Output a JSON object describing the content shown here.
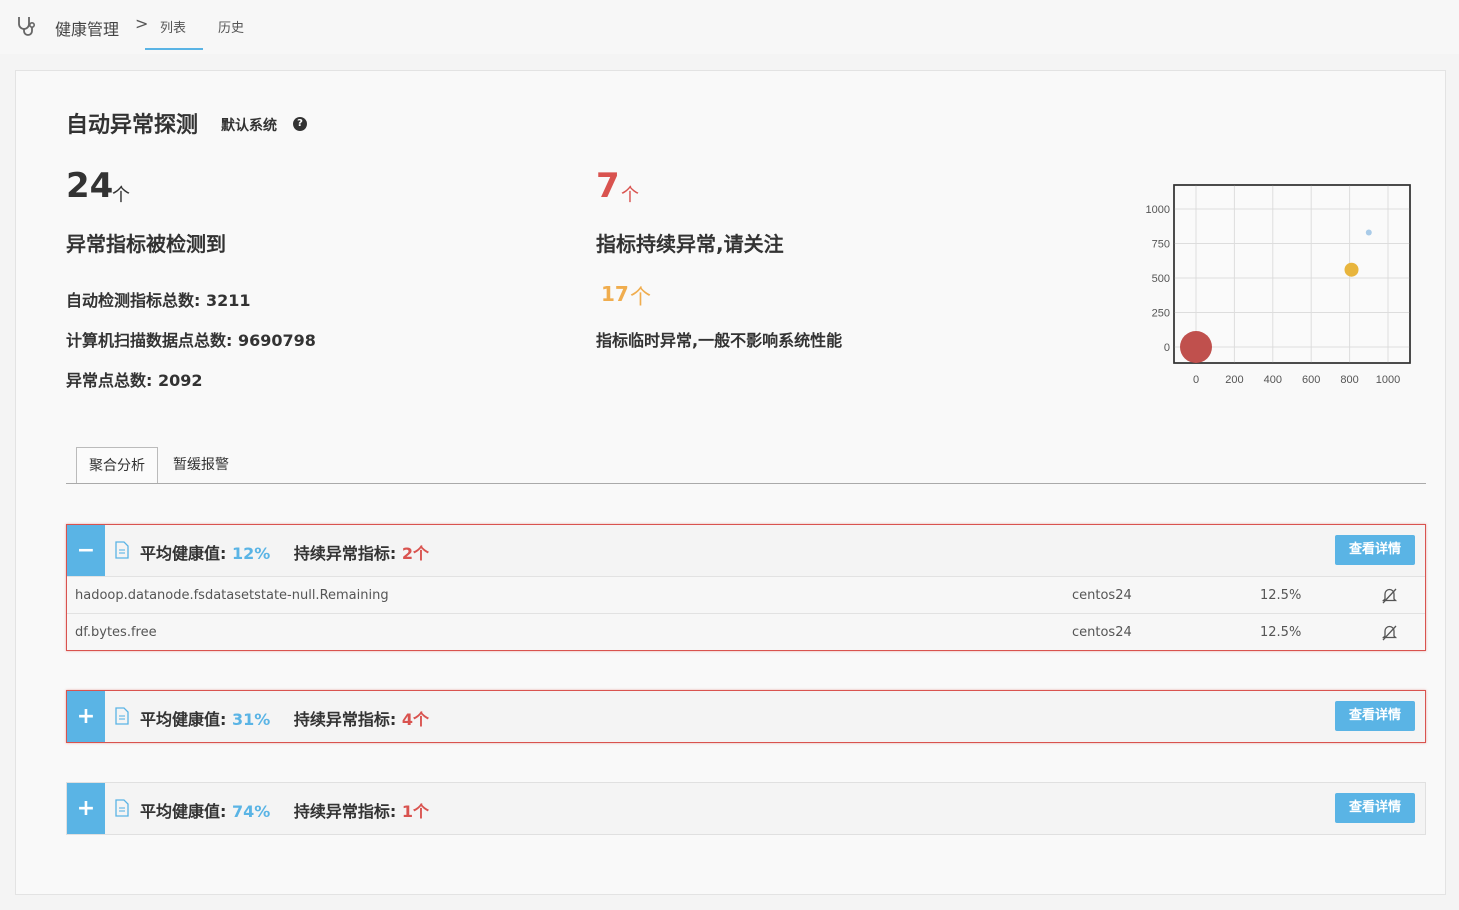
{
  "nav": {
    "title": "健康管理",
    "separator": ">",
    "tabs": [
      {
        "label": "列表",
        "active": true
      },
      {
        "label": "历史",
        "active": false
      }
    ]
  },
  "header": {
    "title": "自动异常探测",
    "subtitle": "默认系统",
    "help_glyph": "?"
  },
  "stats": {
    "detected": {
      "value": "24",
      "unit": "个",
      "label": "异常指标被检测到"
    },
    "persistent": {
      "value": "7",
      "unit": "个",
      "label": "指标持续异常,请关注"
    },
    "temporary": {
      "value": "17",
      "unit": "个",
      "label": "指标临时异常,一般不影响系统性能"
    },
    "totals": [
      "自动检测指标总数: 3211",
      "计算机扫描数据点总数: 9690798",
      "异常点总数: 2092"
    ]
  },
  "colors": {
    "accent": "#5ab4e5",
    "danger": "#d9534f",
    "warning": "#f0ad4e"
  },
  "chart_data": {
    "type": "scatter",
    "x_ticks": [
      "0",
      "200",
      "400",
      "600",
      "800",
      "1000"
    ],
    "y_ticks": [
      "1000",
      "750",
      "500",
      "250",
      "0"
    ],
    "xlim": [
      0,
      1000
    ],
    "ylim": [
      0,
      1000
    ],
    "grid": true,
    "points": [
      {
        "x": 0,
        "y": 0,
        "size": 16,
        "color": "#c0504d"
      },
      {
        "x": 810,
        "y": 560,
        "size": 7,
        "color": "#e8b53d"
      },
      {
        "x": 900,
        "y": 830,
        "size": 3,
        "color": "#a9cbe8"
      }
    ]
  },
  "tabs": [
    {
      "label": "聚合分析",
      "active": true
    },
    {
      "label": "暂缓报警",
      "active": false
    }
  ],
  "groups": [
    {
      "expanded": true,
      "alert": true,
      "toggle_glyph": "−",
      "health_label": "平均健康值:",
      "health_value": "12%",
      "anom_label": "持续异常指标:",
      "anom_value": "2个",
      "button_label": "查看详情",
      "rows": [
        {
          "metric": "hadoop.datanode.fsdatasetstate-null.Remaining",
          "host": "centos24",
          "percent": "12.5%"
        },
        {
          "metric": "df.bytes.free",
          "host": "centos24",
          "percent": "12.5%"
        }
      ]
    },
    {
      "expanded": false,
      "alert": true,
      "toggle_glyph": "+",
      "health_label": "平均健康值:",
      "health_value": "31%",
      "anom_label": "持续异常指标:",
      "anom_value": "4个",
      "button_label": "查看详情",
      "rows": []
    },
    {
      "expanded": false,
      "alert": false,
      "toggle_glyph": "+",
      "health_label": "平均健康值:",
      "health_value": "74%",
      "anom_label": "持续异常指标:",
      "anom_value": "1个",
      "button_label": "查看详情",
      "rows": []
    }
  ]
}
